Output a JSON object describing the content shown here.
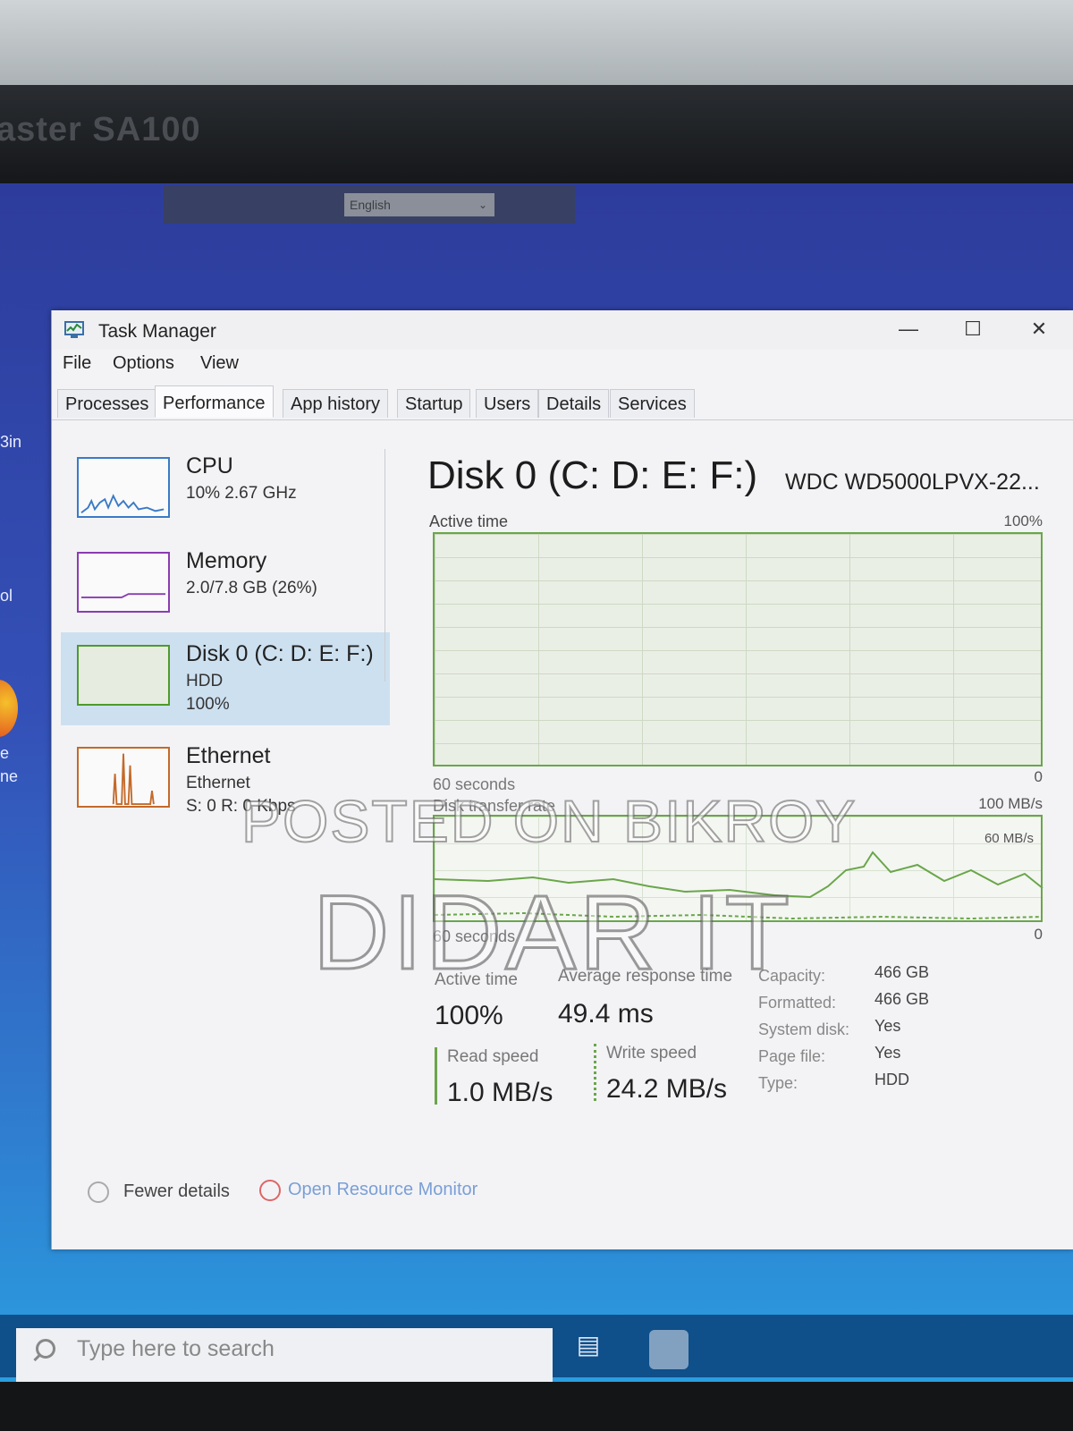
{
  "monitor": {
    "brand": "aster SA100"
  },
  "language_bar": {
    "selected": "English"
  },
  "desktop_edge": {
    "label_1": "3in",
    "label_2": "ol",
    "label_3": "e",
    "label_4": "ne"
  },
  "window": {
    "title": "Task Manager",
    "menu": [
      "File",
      "Options",
      "View"
    ],
    "tabs": [
      "Processes",
      "Performance",
      "App history",
      "Startup",
      "Users",
      "Details",
      "Services"
    ],
    "active_tab": "Performance"
  },
  "sidebar": {
    "items": [
      {
        "title": "CPU",
        "line1": "10% 2.67 GHz",
        "line2": ""
      },
      {
        "title": "Memory",
        "line1": "2.0/7.8 GB (26%)",
        "line2": ""
      },
      {
        "title": "Disk 0 (C: D: E: F:)",
        "line1": "HDD",
        "line2": "100%"
      },
      {
        "title": "Ethernet",
        "line1": "Ethernet",
        "line2": "S: 0 R: 0 Kbps"
      }
    ],
    "selected_index": 2
  },
  "detail": {
    "title": "Disk 0 (C: D: E: F:)",
    "model": "WDC WD5000LPVX-22...",
    "active_graph": {
      "label": "Active time",
      "max": "100%",
      "min": "0",
      "time": "60 seconds",
      "value": 100
    },
    "transfer_graph": {
      "label": "Disk transfer rate",
      "max": "100 MB/s",
      "mid": "60 MB/s",
      "min": "0",
      "time": "60 seconds"
    },
    "stats": {
      "active_time_label": "Active time",
      "active_time": "100%",
      "avg_response_label": "Average response time",
      "avg_response": "49.4 ms",
      "read_label": "Read speed",
      "read": "1.0 MB/s",
      "write_label": "Write speed",
      "write": "24.2 MB/s"
    },
    "properties": [
      {
        "key": "Capacity:",
        "value": "466 GB"
      },
      {
        "key": "Formatted:",
        "value": "466 GB"
      },
      {
        "key": "System disk:",
        "value": "Yes"
      },
      {
        "key": "Page file:",
        "value": "Yes"
      },
      {
        "key": "Type:",
        "value": "HDD"
      }
    ]
  },
  "footer": {
    "fewer_details": "Fewer details",
    "resource_monitor": "Open Resource Monitor"
  },
  "taskbar": {
    "search_placeholder": "Type here to search"
  },
  "watermark": {
    "line1": "POSTED ON BIKROY",
    "line2": "DIDAR IT"
  },
  "colors": {
    "disk_green": "#6aa64a",
    "selection": "#cde0f0",
    "desktop_blue": "#3451b8"
  }
}
